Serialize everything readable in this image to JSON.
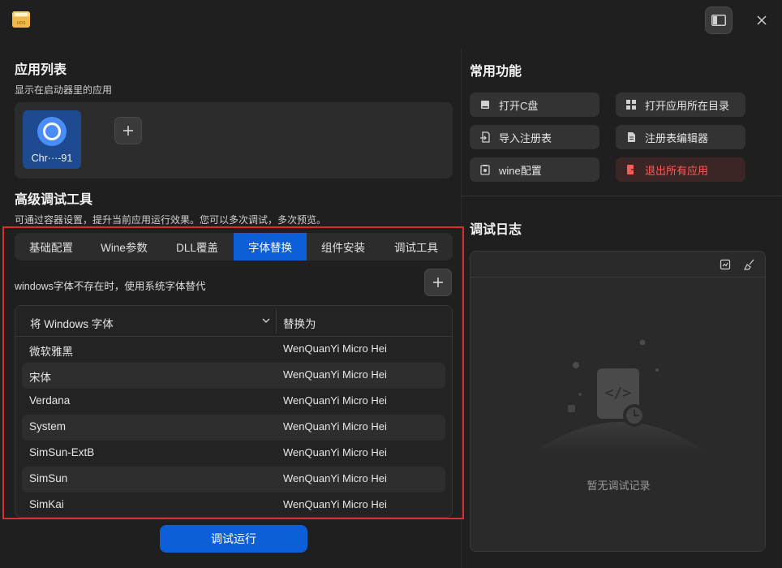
{
  "window": {
    "app_icon": "uos-package-icon",
    "app_icon_label": "UOS",
    "sidebar_toggle_icon": "sidebar-toggle-icon",
    "close_icon": "close-icon"
  },
  "app_list": {
    "title": "应用列表",
    "subtitle": "显示在启动器里的应用",
    "apps": [
      {
        "name": "Chr···-91",
        "icon": "chrome-icon"
      }
    ],
    "add_icon": "plus-icon"
  },
  "advanced": {
    "title": "高级调试工具",
    "subtitle": "可通过容器设置，提升当前应用运行效果。您可以多次调试，多次预览。",
    "tabs": [
      "基础配置",
      "Wine参数",
      "DLL覆盖",
      "字体替换",
      "组件安装",
      "调试工具"
    ],
    "active_tab": "字体替换",
    "font_desc": "windows字体不存在时，使用系统字体替代",
    "add_font_icon": "plus-icon",
    "table": {
      "col1_header": "将 Windows 字体",
      "col2_header": "替换为",
      "rows": [
        [
          "微软雅黑",
          "WenQuanYi Micro Hei"
        ],
        [
          "宋体",
          "WenQuanYi Micro Hei"
        ],
        [
          "Verdana",
          "WenQuanYi Micro Hei"
        ],
        [
          "System",
          "WenQuanYi Micro Hei"
        ],
        [
          "SimSun-ExtB",
          "WenQuanYi Micro Hei"
        ],
        [
          "SimSun",
          "WenQuanYi Micro Hei"
        ],
        [
          "SimKai",
          "WenQuanYi Micro Hei"
        ]
      ]
    },
    "run_label": "调试运行"
  },
  "common": {
    "title": "常用功能",
    "buttons": [
      {
        "label": "打开C盘",
        "icon": "drive-icon"
      },
      {
        "label": "打开应用所在目录",
        "icon": "folder-icon"
      },
      {
        "label": "导入注册表",
        "icon": "import-icon"
      },
      {
        "label": "注册表编辑器",
        "icon": "registry-icon"
      },
      {
        "label": "wine配置",
        "icon": "config-icon"
      },
      {
        "label": "退出所有应用",
        "icon": "exit-icon"
      }
    ],
    "danger_color": "#ff5a5a"
  },
  "log": {
    "title": "调试日志",
    "empty_text": "暂无调试记录",
    "toolbar_icons": [
      "save-log-icon",
      "clear-log-icon"
    ],
    "empty_icon": "code-file-icon"
  },
  "colors": {
    "accent": "#0d5fd8",
    "highlight_border": "#e02b2b"
  }
}
